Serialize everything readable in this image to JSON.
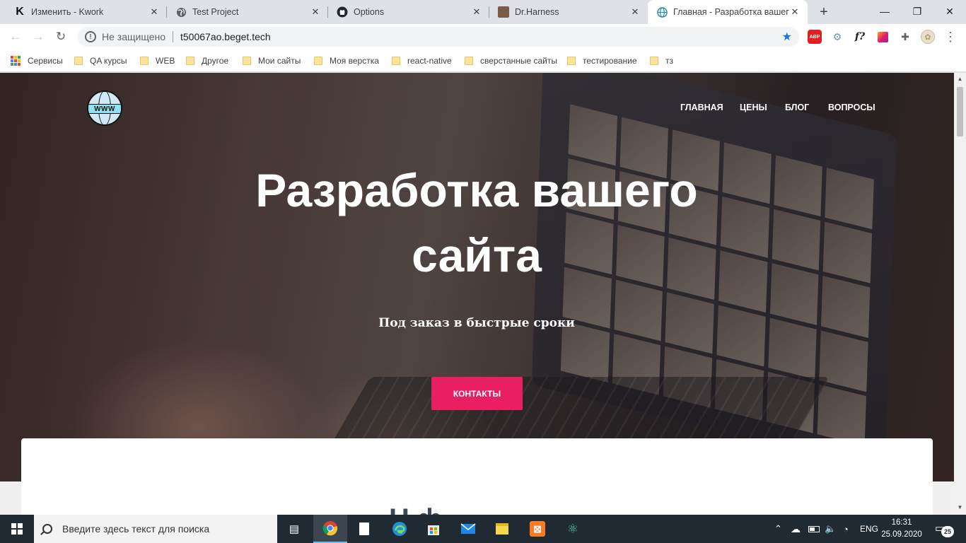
{
  "browser": {
    "tabs": [
      {
        "title": "Изменить - Kwork",
        "icon": "kwork-k-icon"
      },
      {
        "title": "Test Project",
        "icon": "globe-icon"
      },
      {
        "title": "Options",
        "icon": "github-icon"
      },
      {
        "title": "Dr.Harness",
        "icon": "avatar-favicon"
      },
      {
        "title": "Главная - Разработка вашего",
        "icon": "globe-icon",
        "active": true
      }
    ],
    "security_label": "Не защищено",
    "url": "t50067ao.beget.tech",
    "abp_label": "ABP",
    "fx_label": "f?",
    "bookmarks": [
      {
        "label": "Сервисы",
        "icon": "apps-grid-icon"
      },
      {
        "label": "QA курсы"
      },
      {
        "label": "WEB"
      },
      {
        "label": "Другое"
      },
      {
        "label": "Мои сайты"
      },
      {
        "label": "Моя верстка"
      },
      {
        "label": "react-native"
      },
      {
        "label": "сверстанные сайты"
      },
      {
        "label": "тестирование"
      },
      {
        "label": "тз"
      }
    ]
  },
  "site": {
    "logo_text": "WWW",
    "nav": [
      "ГЛАВНАЯ",
      "ЦЕНЫ",
      "БЛОГ",
      "ВОПРОСЫ"
    ],
    "hero_title_line1": "Разработка вашего",
    "hero_title_line2": "сайта",
    "hero_subtitle": "Под заказ в быстрые сроки",
    "cta_label": "КОНТАКТЫ",
    "section_heading_partial": "Н                    ф",
    "accent_color": "#e91e63"
  },
  "taskbar": {
    "search_placeholder": "Введите здесь текст для поиска",
    "language": "ENG",
    "time": "16:31",
    "date": "25.09.2020",
    "notification_count": "25"
  }
}
